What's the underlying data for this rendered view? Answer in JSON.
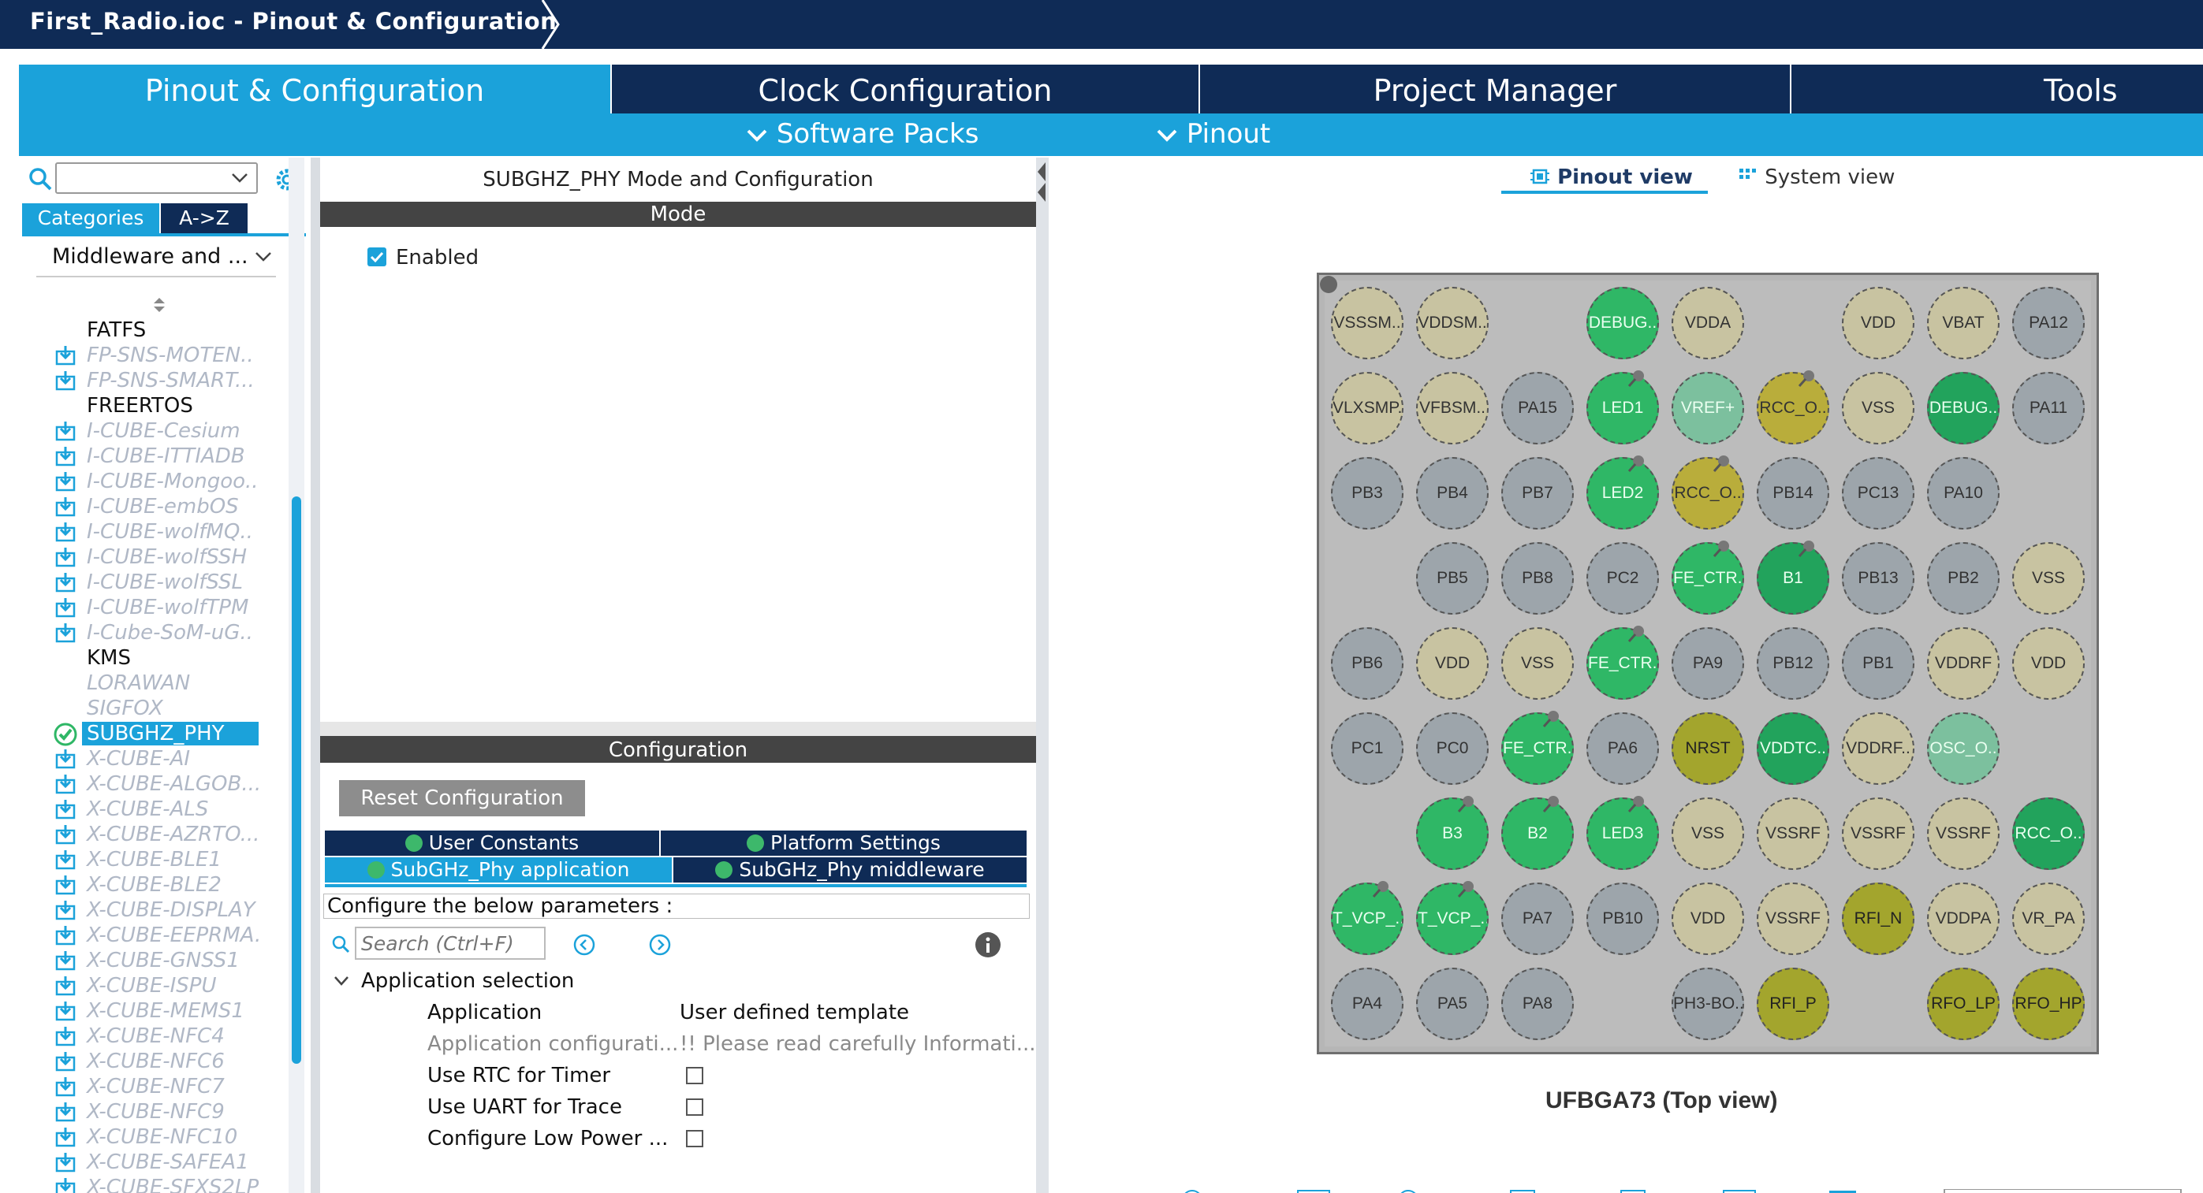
{
  "title": "First_Radio.ioc - Pinout & Configuration",
  "main_tabs": [
    "Pinout & Configuration",
    "Clock Configuration",
    "Project Manager",
    "Tools"
  ],
  "sub_menus": [
    "Software Packs",
    "Pinout"
  ],
  "left": {
    "tabs": [
      "Categories",
      "A->Z"
    ],
    "category": "Middleware and ...",
    "items": [
      {
        "label": "FATFS",
        "style": "bold"
      },
      {
        "label": "FP-SNS-MOTEN..",
        "style": "pack"
      },
      {
        "label": "FP-SNS-SMART...",
        "style": "pack"
      },
      {
        "label": "FREERTOS",
        "style": "bold"
      },
      {
        "label": "I-CUBE-Cesium",
        "style": "pack"
      },
      {
        "label": "I-CUBE-ITTIADB",
        "style": "pack"
      },
      {
        "label": "I-CUBE-Mongoo..",
        "style": "pack"
      },
      {
        "label": "I-CUBE-embOS",
        "style": "pack"
      },
      {
        "label": "I-CUBE-wolfMQ..",
        "style": "pack"
      },
      {
        "label": "I-CUBE-wolfSSH",
        "style": "pack"
      },
      {
        "label": "I-CUBE-wolfSSL",
        "style": "pack"
      },
      {
        "label": "I-CUBE-wolfTPM",
        "style": "pack"
      },
      {
        "label": "I-Cube-SoM-uG..",
        "style": "pack"
      },
      {
        "label": "KMS",
        "style": "bold"
      },
      {
        "label": "LORAWAN",
        "style": "plain"
      },
      {
        "label": "SIGFOX",
        "style": "plain"
      },
      {
        "label": "SUBGHZ_PHY",
        "style": "selected"
      },
      {
        "label": "X-CUBE-AI",
        "style": "pack"
      },
      {
        "label": "X-CUBE-ALGOB...",
        "style": "pack"
      },
      {
        "label": "X-CUBE-ALS",
        "style": "pack"
      },
      {
        "label": "X-CUBE-AZRTO...",
        "style": "pack"
      },
      {
        "label": "X-CUBE-BLE1",
        "style": "pack"
      },
      {
        "label": "X-CUBE-BLE2",
        "style": "pack"
      },
      {
        "label": "X-CUBE-DISPLAY",
        "style": "pack"
      },
      {
        "label": "X-CUBE-EEPRMA.",
        "style": "pack"
      },
      {
        "label": "X-CUBE-GNSS1",
        "style": "pack"
      },
      {
        "label": "X-CUBE-ISPU",
        "style": "pack"
      },
      {
        "label": "X-CUBE-MEMS1",
        "style": "pack"
      },
      {
        "label": "X-CUBE-NFC4",
        "style": "pack"
      },
      {
        "label": "X-CUBE-NFC6",
        "style": "pack"
      },
      {
        "label": "X-CUBE-NFC7",
        "style": "pack"
      },
      {
        "label": "X-CUBE-NFC9",
        "style": "pack"
      },
      {
        "label": "X-CUBE-NFC10",
        "style": "pack"
      },
      {
        "label": "X-CUBE-SAFEA1",
        "style": "pack"
      },
      {
        "label": "X-CUBE-SFXS2LP",
        "style": "pack"
      }
    ]
  },
  "middle": {
    "header": "SUBGHZ_PHY Mode and Configuration",
    "mode_label": "Mode",
    "enabled_label": "Enabled",
    "config_label": "Configuration",
    "reset_button": "Reset Configuration",
    "tabs_row1": [
      "User Constants",
      "Platform Settings"
    ],
    "tabs_row2": [
      "SubGHz_Phy application",
      "SubGHz_Phy middleware"
    ],
    "configure_text": "Configure the below parameters :",
    "search_placeholder": "Search (Ctrl+F)",
    "group": "Application selection",
    "params": [
      {
        "name": "Application",
        "value": "User defined template",
        "style": "normal",
        "check": false
      },
      {
        "name": "Application configurati...",
        "value": "!! Please read carefully Informati...",
        "style": "gray",
        "check": false
      },
      {
        "name": "Use RTC for Timer",
        "value": "",
        "style": "normal",
        "check": true
      },
      {
        "name": "Use UART for Trace",
        "value": "",
        "style": "normal",
        "check": true
      },
      {
        "name": "Configure Low Power ...",
        "value": "",
        "style": "normal",
        "check": true
      }
    ]
  },
  "right": {
    "view_tabs": [
      "Pinout view",
      "System view"
    ],
    "caption": "UFBGA73 (Top view)",
    "pin_rows": [
      [
        [
          "VSSSM..",
          "beige"
        ],
        [
          "VDDSM..",
          "beige"
        ],
        null,
        [
          "DEBUG..",
          "green"
        ],
        [
          "VDDA",
          "beige"
        ],
        null,
        [
          "VDD",
          "beige"
        ],
        [
          "VBAT",
          "beige"
        ],
        [
          "PA12",
          "gray"
        ]
      ],
      [
        [
          "VLXSMP..",
          "beige"
        ],
        [
          "VFBSM..",
          "beige"
        ],
        [
          "PA15",
          "gray"
        ],
        [
          "LED1",
          "green",
          "pin"
        ],
        [
          "VREF+",
          "lgreen"
        ],
        [
          "RCC_O..",
          "yellow",
          "pin"
        ],
        [
          "VSS",
          "beige"
        ],
        [
          "DEBUG..",
          "dgreen"
        ],
        [
          "PA11",
          "gray"
        ]
      ],
      [
        [
          "PB3",
          "gray"
        ],
        [
          "PB4",
          "gray"
        ],
        [
          "PB7",
          "gray"
        ],
        [
          "LED2",
          "green",
          "pin"
        ],
        [
          "RCC_O..",
          "yellow",
          "pin"
        ],
        [
          "PB14",
          "gray"
        ],
        [
          "PC13",
          "gray"
        ],
        [
          "PA10",
          "gray"
        ],
        null
      ],
      [
        null,
        [
          "PB5",
          "gray"
        ],
        [
          "PB8",
          "gray"
        ],
        [
          "PC2",
          "gray"
        ],
        [
          "FE_CTR..",
          "green",
          "pin"
        ],
        [
          "B1",
          "dgreen",
          "pin"
        ],
        [
          "PB13",
          "gray"
        ],
        [
          "PB2",
          "gray"
        ],
        [
          "VSS",
          "beige"
        ]
      ],
      [
        [
          "PB6",
          "gray"
        ],
        [
          "VDD",
          "beige"
        ],
        [
          "VSS",
          "beige"
        ],
        [
          "FE_CTR..",
          "green",
          "pin"
        ],
        [
          "PA9",
          "gray"
        ],
        [
          "PB12",
          "gray"
        ],
        [
          "PB1",
          "gray"
        ],
        [
          "VDDRF",
          "beige"
        ],
        [
          "VDD",
          "beige"
        ]
      ],
      [
        [
          "PC1",
          "gray"
        ],
        [
          "PC0",
          "gray"
        ],
        [
          "FE_CTR..",
          "green",
          "pin"
        ],
        [
          "PA6",
          "gray"
        ],
        [
          "NRST",
          "olive"
        ],
        [
          "VDDTC..",
          "dgreen"
        ],
        [
          "VDDRF..",
          "beige"
        ],
        [
          "OSC_O..",
          "lgreen"
        ],
        null
      ],
      [
        null,
        [
          "B3",
          "green",
          "pin"
        ],
        [
          "B2",
          "green",
          "pin"
        ],
        [
          "LED3",
          "green",
          "pin"
        ],
        [
          "VSS",
          "beige"
        ],
        [
          "VSSRF",
          "beige"
        ],
        [
          "VSSRF",
          "beige"
        ],
        [
          "VSSRF",
          "beige"
        ],
        [
          "RCC_O..",
          "dgreen"
        ]
      ],
      [
        [
          "T_VCP_..",
          "green",
          "pin"
        ],
        [
          "T_VCP_..",
          "green",
          "pin"
        ],
        [
          "PA7",
          "gray"
        ],
        [
          "PB10",
          "gray"
        ],
        [
          "VDD",
          "beige"
        ],
        [
          "VSSRF",
          "beige"
        ],
        [
          "RFI_N",
          "olive"
        ],
        [
          "VDDPA",
          "beige"
        ],
        [
          "VR_PA",
          "beige"
        ]
      ],
      [
        [
          "PA4",
          "gray"
        ],
        [
          "PA5",
          "gray"
        ],
        [
          "PA8",
          "gray"
        ],
        null,
        [
          "PH3-BO..",
          "gray"
        ],
        [
          "RFI_P",
          "olive"
        ],
        null,
        [
          "RFO_LP",
          "olive"
        ],
        [
          "RFO_HP",
          "olive"
        ]
      ]
    ]
  }
}
